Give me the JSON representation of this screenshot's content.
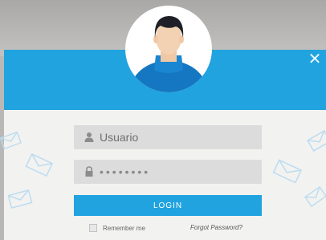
{
  "login": {
    "username_placeholder": "Usuario",
    "password_value": "••••••••",
    "login_label": "LOGIN",
    "remember_label": "Remember me",
    "forgot_label": "Forgot Password?",
    "close_icon": "close-icon",
    "user_icon": "user-icon",
    "lock_icon": "lock-icon",
    "avatar_icon": "avatar-icon",
    "envelope_icon": "envelope-icon"
  },
  "colors": {
    "accent": "#21a3df",
    "card_bg": "#f2f2f1",
    "field_bg": "#dcdcdc",
    "backdrop": "#b9b8b6"
  }
}
